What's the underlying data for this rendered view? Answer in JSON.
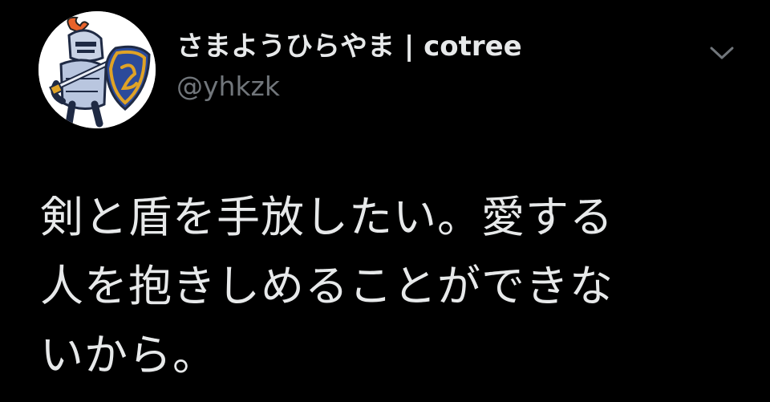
{
  "author": {
    "display_name": "さまようひらやま | cotree",
    "handle": "@yhkzk",
    "avatar_icon": "knight-with-sword-and-shield-avatar"
  },
  "more_icon": "chevron-down-icon",
  "tweet": {
    "lines": [
      "剣と盾を手放したい。愛する",
      "人を抱きしめることができな",
      "いから。"
    ]
  },
  "colors": {
    "background": "#000000",
    "primary_text": "#e7e9ea",
    "secondary_text": "#71767b"
  }
}
